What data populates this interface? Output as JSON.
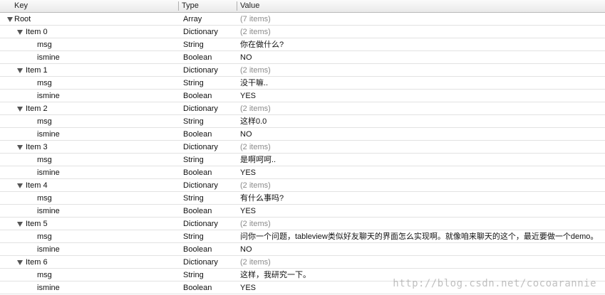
{
  "columns": {
    "key": "Key",
    "type": "Type",
    "value": "Value"
  },
  "root": {
    "key": "Root",
    "type": "Array",
    "value": "(7 items)"
  },
  "items": [
    {
      "key": "Item 0",
      "type": "Dictionary",
      "count": "(2 items)",
      "msg": "你在做什么?",
      "ismine": "NO"
    },
    {
      "key": "Item 1",
      "type": "Dictionary",
      "count": "(2 items)",
      "msg": "没干嘛..",
      "ismine": "YES"
    },
    {
      "key": "Item 2",
      "type": "Dictionary",
      "count": "(2 items)",
      "msg": "这样0.0",
      "ismine": "NO"
    },
    {
      "key": "Item 3",
      "type": "Dictionary",
      "count": "(2 items)",
      "msg": "是啊呵呵..",
      "ismine": "YES"
    },
    {
      "key": "Item 4",
      "type": "Dictionary",
      "count": "(2 items)",
      "msg": "有什么事吗?",
      "ismine": "YES"
    },
    {
      "key": "Item 5",
      "type": "Dictionary",
      "count": "(2 items)",
      "msg": "问你一个问题，tableview类似好友聊天的界面怎么实现啊。就像咱来聊天的这个，最近要做一个demo。",
      "ismine": "NO"
    },
    {
      "key": "Item 6",
      "type": "Dictionary",
      "count": "(2 items)",
      "msg": "这样，我研究一下。",
      "ismine": "YES"
    }
  ],
  "child_labels": {
    "msg_key": "msg",
    "msg_type": "String",
    "ismine_key": "ismine",
    "ismine_type": "Boolean"
  },
  "watermark": "http://blog.csdn.net/cocoarannie"
}
